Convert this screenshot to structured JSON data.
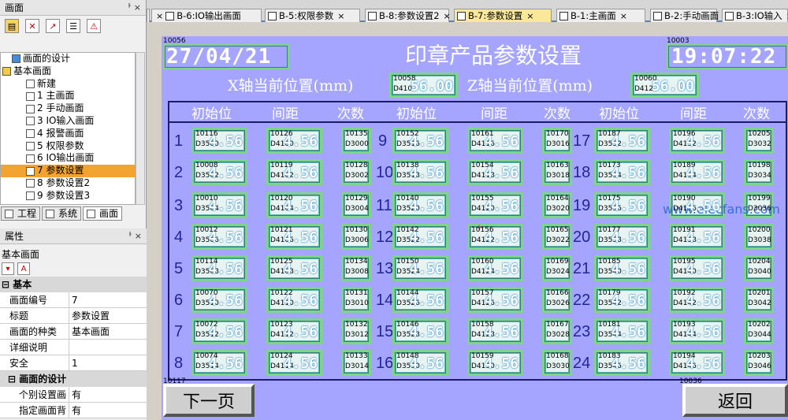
{
  "left_panel": {
    "title": "画面",
    "pin": "ᅡ ×",
    "tree": [
      {
        "label": "画面的设计",
        "level": 0
      },
      {
        "label": "基本画面",
        "level": 0
      },
      {
        "label": "新建",
        "level": 2
      },
      {
        "label": "1 主画面",
        "level": 2
      },
      {
        "label": "2 手动画面",
        "level": 2
      },
      {
        "label": "3 IO输入画面",
        "level": 2
      },
      {
        "label": "4 报警画面",
        "level": 2
      },
      {
        "label": "5 权限参数",
        "level": 2
      },
      {
        "label": "6 IO输出画面",
        "level": 2
      },
      {
        "label": "7 参数设置",
        "level": 2,
        "selected": true
      },
      {
        "label": "8 参数设置2",
        "level": 2
      },
      {
        "label": "9 参数设置3",
        "level": 2
      }
    ],
    "bottom_tabs": [
      "工程",
      "系统",
      "画面"
    ],
    "props_title": "属性",
    "props_sub": "基本画面",
    "props_group_basic": "基本",
    "props": [
      {
        "k": "画面编号",
        "v": "7"
      },
      {
        "k": "标题",
        "v": "参数设置"
      },
      {
        "k": "画面的种类",
        "v": "基本画面"
      },
      {
        "k": "详细说明",
        "v": ""
      },
      {
        "k": "安全",
        "v": "1"
      }
    ],
    "props_group_design": "画面的设计",
    "props2": [
      {
        "k": "个别设置画",
        "v": "有"
      },
      {
        "k": "指定画面背",
        "v": "有"
      }
    ]
  },
  "tabs": [
    {
      "label": "B-6:IO输出画面"
    },
    {
      "label": "B-5:权限参数"
    },
    {
      "label": "B-8:参数设置2"
    },
    {
      "label": "B-7:参数设置",
      "active": true
    },
    {
      "label": "B-1:主画面"
    },
    {
      "label": "B-2:手动画面"
    },
    {
      "label": "B-3:IO输入"
    }
  ],
  "screen": {
    "date_id": "10056",
    "date": "27/04/21",
    "title": "印章产品参数设置",
    "time_id": "10003",
    "time": "19:07:22",
    "x_label": "X轴当前位置(mm)",
    "x_id": "10058",
    "x_addr": "D410",
    "x_val": "56.00",
    "z_label": "Z轴当前位置(mm)",
    "z_id": "10060",
    "z_addr": "D412",
    "z_val": "56.00",
    "headers": [
      "初始位",
      "间距",
      "次数",
      "初始位",
      "间距",
      "次数",
      "初始位",
      "间距",
      "次数"
    ],
    "row_nums": [
      [
        "1",
        "2",
        "3",
        "4",
        "5",
        "6",
        "7",
        "8"
      ],
      [
        "9",
        "10",
        "11",
        "12",
        "13",
        "14",
        "15",
        "16"
      ],
      [
        "17",
        "18",
        "19",
        "20",
        "21",
        "22",
        "23",
        "24"
      ]
    ],
    "cell_value": "4.56",
    "columns": [
      {
        "ids": [
          "10116",
          "10008",
          "10010",
          "10012",
          "10114",
          "10070",
          "10072",
          "10074"
        ],
        "addrs": [
          "D3500",
          "D3502",
          "D3504",
          "D3506",
          "D3508",
          "D3510",
          "D3512",
          "D3514"
        ]
      },
      {
        "ids": [
          "10126",
          "10119",
          "10120",
          "10121",
          "10125",
          "10122",
          "10123",
          "10124"
        ],
        "addrs": [
          "D4100",
          "D4102",
          "D4104",
          "D4106",
          "D4108",
          "D4110",
          "D4112",
          "D4114"
        ]
      },
      {
        "ids": [
          "10135",
          "10128",
          "10129",
          "10130",
          "10134",
          "10131",
          "10132",
          "10133"
        ],
        "addrs": [
          "D3000",
          "D3002",
          "D3004",
          "D3006",
          "D3008",
          "D3010",
          "D3012",
          "D3014"
        ]
      },
      {
        "ids": [
          "10152",
          "10138",
          "10140",
          "10142",
          "10150",
          "10144",
          "10146",
          "10148"
        ],
        "addrs": [
          "D3516",
          "D3518",
          "D3520",
          "D3522",
          "D3524",
          "D3526",
          "D3528",
          "D3530"
        ]
      },
      {
        "ids": [
          "10161",
          "10154",
          "10155",
          "10156",
          "10160",
          "10157",
          "10158",
          "10159"
        ],
        "addrs": [
          "D4116",
          "D4118",
          "D4120",
          "D4122",
          "D4124",
          "D4126",
          "D4128",
          "D4130"
        ]
      },
      {
        "ids": [
          "10170",
          "10163",
          "10164",
          "10165",
          "10169",
          "10166",
          "10167",
          "10168"
        ],
        "addrs": [
          "D3016",
          "D3018",
          "D3020",
          "D3022",
          "D3024",
          "D3026",
          "D3028",
          "D3030"
        ]
      },
      {
        "ids": [
          "10187",
          "10173",
          "10175",
          "10177",
          "10185",
          "10179",
          "10181",
          "10183"
        ],
        "addrs": [
          "D3532",
          "D3534",
          "D3536",
          "D3538",
          "D3540",
          "D3542",
          "D3544",
          "D3546"
        ]
      },
      {
        "ids": [
          "10196",
          "10189",
          "10190",
          "10191",
          "10195",
          "10192",
          "10193",
          "10194"
        ],
        "addrs": [
          "D4132",
          "D4134",
          "D4136",
          "D4138",
          "D4140",
          "D4142",
          "D4144",
          "D4146"
        ]
      },
      {
        "ids": [
          "10205",
          "10198",
          "10199",
          "10200",
          "10204",
          "10201",
          "10202",
          "10203"
        ],
        "addrs": [
          "D3032",
          "D3034",
          "D3036",
          "D3038",
          "D3040",
          "D3042",
          "D3044",
          "D3046"
        ]
      }
    ],
    "watermark": "www.elecfans.com",
    "next_id": "10117",
    "next_label": "下一页",
    "back_id": "10036",
    "back_label": "返回"
  }
}
